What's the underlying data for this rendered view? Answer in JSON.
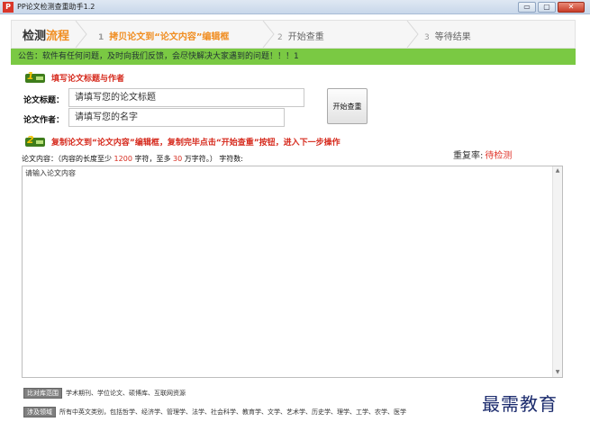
{
  "window": {
    "app_icon_text": "P",
    "title": "PP论文检测查重助手1.2",
    "min_glyph": "▭",
    "max_glyph": "▢",
    "close_glyph": "✕"
  },
  "steps": {
    "header_prefix": "检测",
    "header_highlight": "流程",
    "items": [
      {
        "num": "1",
        "label": "拷贝论文到“论文内容”编辑框",
        "active": true
      },
      {
        "num": "2",
        "label": "开始查重",
        "active": false
      },
      {
        "num": "3",
        "label": "等待结果",
        "active": false
      }
    ]
  },
  "notice": "公告：软件有任何问题，及时向我们反馈，会尽快解决大家遇到的问题！！！1",
  "section1": {
    "num": "1",
    "title": "填写论文标题与作者",
    "title_label": "论文标题：",
    "title_placeholder": "请填写您的论文标题",
    "author_label": "论文作者：",
    "author_placeholder": "请填写您的名字",
    "start_button": "开始查重"
  },
  "section2": {
    "num": "2",
    "title": "复制论文到“论文内容”编辑框，复制完毕点击“开始查重”按钮，进入下一步操作"
  },
  "content": {
    "label": "论文内容：（内容的长度至少 ",
    "min_chars": "1200",
    "mid": " 字符，至多 ",
    "max_chars": "30",
    "tail": " 万字符。）  字符数:",
    "placeholder": "请输入论文内容"
  },
  "rate": {
    "label": "重复率:",
    "value": "待检测"
  },
  "footer": {
    "compare_tag": "比对库范围",
    "compare_text": "学术期刊、学位论文、硕博库、互联网资源",
    "subject_tag": "涉及领域",
    "subject_text": "所有中英文类别，包括哲学、经济学、管理学、法学、社会科学、教育学、文学、艺术学、历史学、理学、工学、农学、医学"
  },
  "watermark": "最需教育",
  "colors": {
    "accent": "#f08e22",
    "notice_bg": "#7ac943",
    "section_red": "#d62b1e",
    "rate_red": "#e0352b"
  }
}
